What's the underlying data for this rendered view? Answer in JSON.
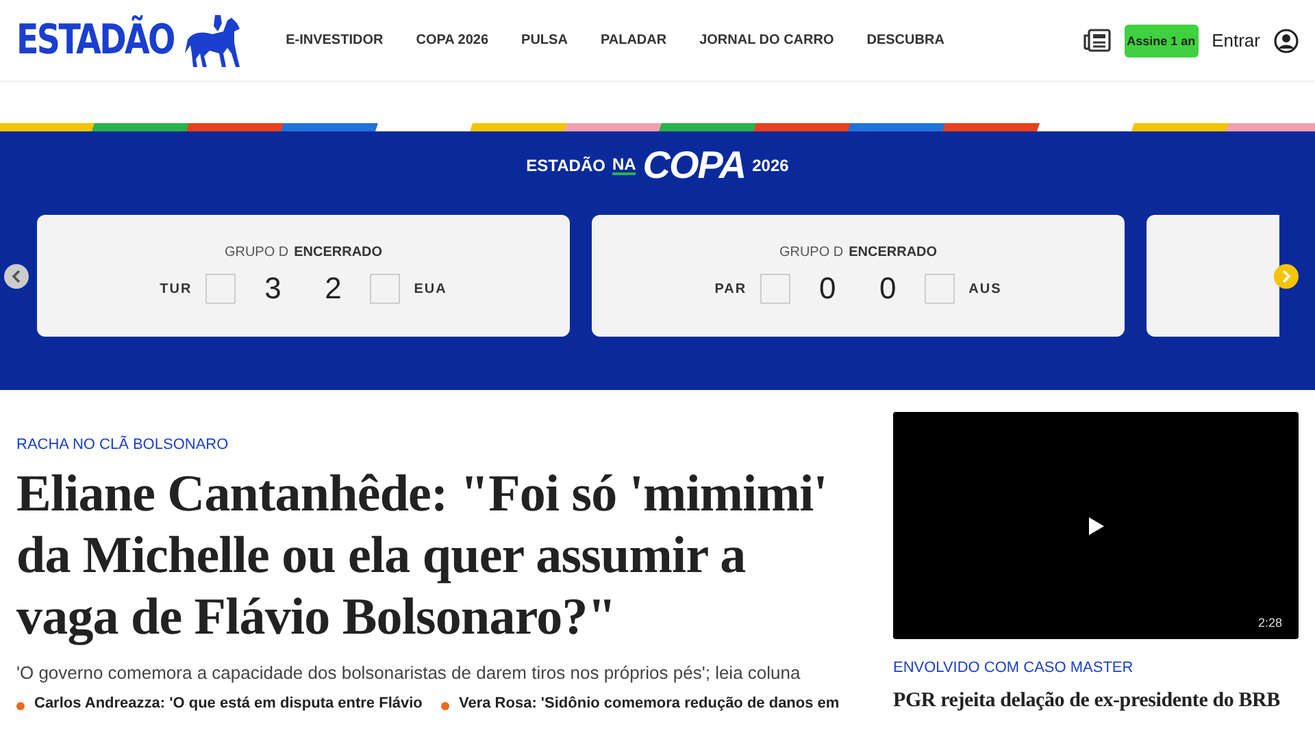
{
  "header": {
    "logo": "ESTADÃO",
    "nav": [
      {
        "label": "E-INVESTIDOR"
      },
      {
        "label": "COPA 2026"
      },
      {
        "label": "PULSA"
      },
      {
        "label": "PALADAR"
      },
      {
        "label": "JORNAL DO CARRO"
      },
      {
        "label": "DESCUBRA"
      }
    ],
    "subscribe": "Assine 1 an",
    "login": "Entrar"
  },
  "copa": {
    "prefix": "ESTADÃO",
    "na": "NA",
    "title": "COPA",
    "year": "2026",
    "matches": [
      {
        "group": "GRUPO D",
        "status": "ENCERRADO",
        "home": "TUR",
        "home_score": "3",
        "away_score": "2",
        "away": "EUA"
      },
      {
        "group": "GRUPO D",
        "status": "ENCERRADO",
        "home": "PAR",
        "home_score": "0",
        "away_score": "0",
        "away": "AUS"
      }
    ]
  },
  "main": {
    "kicker": "RACHA NO CLÃ BOLSONARO",
    "headline": "Eliane Cantanhêde: \"Foi só 'mimimi' da Michelle ou ela quer assumir a vaga de Flávio Bolsonaro?\"",
    "subtitle": "'O governo comemora a capacidade dos bolsonaristas de darem tiros nos próprios pés'; leia coluna",
    "related": [
      "Carlos Andreazza: 'O que está em disputa entre Flávio",
      "Vera Rosa: 'Sidônio comemora redução de danos em"
    ]
  },
  "side": {
    "duration": "2:28",
    "kicker": "ENVOLVIDO COM CASO MASTER",
    "headline": "PGR rejeita delação de ex-presidente do BRB"
  }
}
